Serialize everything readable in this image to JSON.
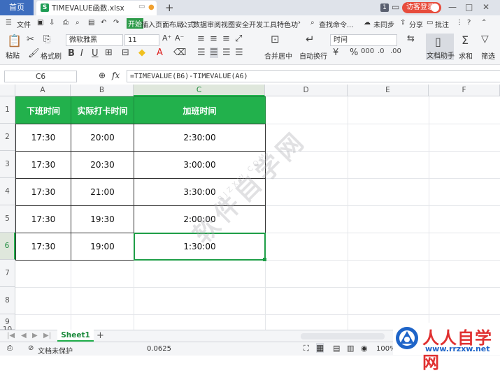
{
  "titlebar": {
    "home_tab": "首页",
    "file_name": "TIMEVALUE函数.xlsx",
    "badge": "1",
    "login": "访客登录",
    "new_tab": "+"
  },
  "menu": {
    "file": "文件",
    "items": [
      "插入",
      "页面布局",
      "公式",
      "数据",
      "审阅",
      "视图",
      "安全",
      "开发工具",
      "特色功"
    ],
    "active": "开始",
    "search": "查找命令...",
    "sync": "未同步",
    "share": "分享",
    "comment": "批注"
  },
  "toolbar": {
    "paste": "粘贴",
    "format_painter": "格式刷",
    "font_name": "微软雅黑",
    "font_size": "11",
    "merge": "合并居中",
    "wrap": "自动换行",
    "number_format": "时间",
    "doc_assist": "文档助手",
    "sum": "求和",
    "filter": "筛选"
  },
  "formula_bar": {
    "name_box": "C6",
    "fx": "fx",
    "formula": "=TIMEVALUE(B6)-TIMEVALUE(A6)"
  },
  "grid": {
    "columns": [
      "A",
      "B",
      "C",
      "D",
      "E",
      "F"
    ],
    "rows": [
      "1",
      "2",
      "3",
      "4",
      "5",
      "6",
      "7",
      "8",
      "9",
      "10"
    ],
    "headers": [
      "下班时间",
      "实际打卡时间",
      "加班时间"
    ],
    "data": [
      [
        "17:30",
        "20:00",
        "2:30:00"
      ],
      [
        "17:30",
        "20:30",
        "3:00:00"
      ],
      [
        "17:30",
        "21:00",
        "3:30:00"
      ],
      [
        "17:30",
        "19:30",
        "2:00:00"
      ],
      [
        "17:30",
        "19:00",
        "1:30:00"
      ]
    ]
  },
  "watermark": {
    "text": "软件自学网",
    "url": "RJZXW.COM"
  },
  "sheets": {
    "active": "Sheet1",
    "add": "+"
  },
  "status": {
    "protect": "文档未保护",
    "value": "0.0625",
    "zoom": "100%"
  },
  "logo": {
    "name": "人人自学网",
    "url": "www.rrzxw.net"
  },
  "colors": {
    "header_green": "#22b14c",
    "selection_green": "#1e9e47",
    "tab_blue": "#3d6dbe",
    "login_red": "#e74c3c"
  }
}
